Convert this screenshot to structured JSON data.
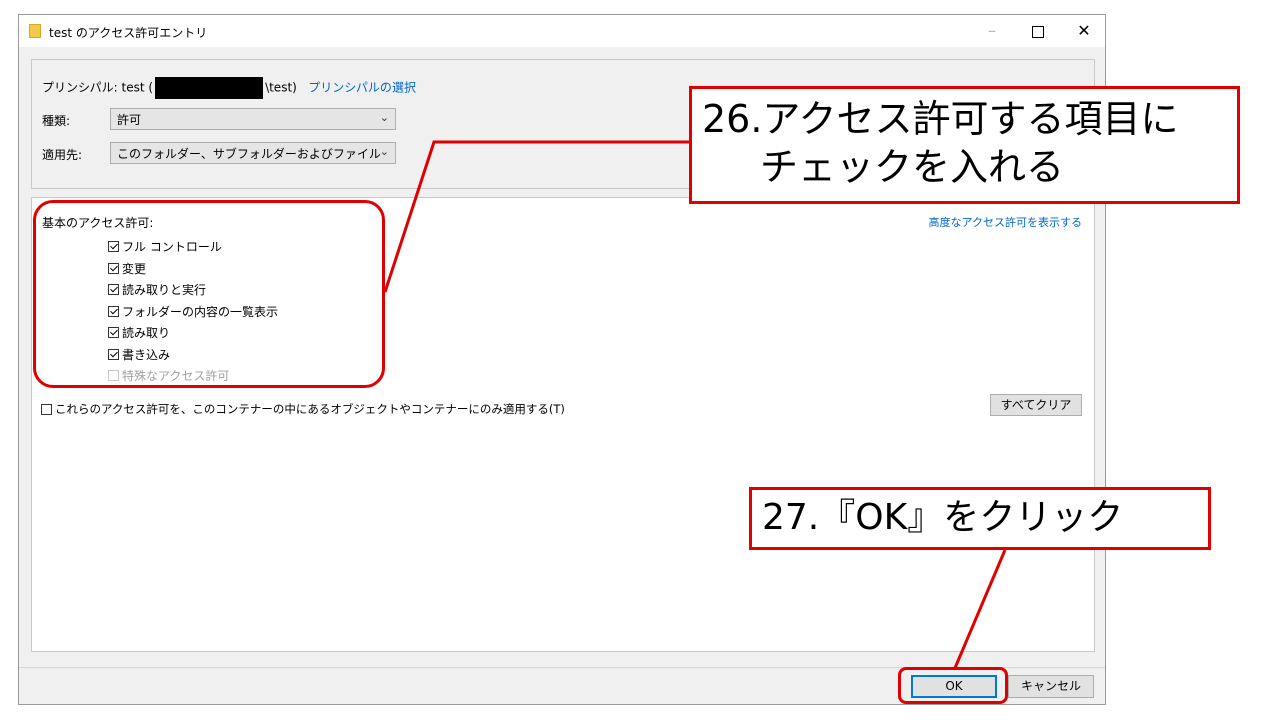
{
  "window": {
    "title": "test のアクセス許可エントリ",
    "controls": {
      "minimize": "–",
      "maximize": "",
      "close": "✕"
    }
  },
  "principal": {
    "label": "プリンシパル:",
    "name_prefix": "test (",
    "name_suffix": "\\test)",
    "select_link": "プリンシパルの選択"
  },
  "type_field": {
    "label": "種類:",
    "value": "許可"
  },
  "applies_field": {
    "label": "適用先:",
    "value": "このフォルダー、サブフォルダーおよびファイル"
  },
  "permissions": {
    "heading": "基本のアクセス許可:",
    "advanced_link": "高度なアクセス許可を表示する",
    "items": [
      {
        "label": "フル コントロール",
        "checked": true,
        "enabled": true
      },
      {
        "label": "変更",
        "checked": true,
        "enabled": true
      },
      {
        "label": "読み取りと実行",
        "checked": true,
        "enabled": true
      },
      {
        "label": "フォルダーの内容の一覧表示",
        "checked": true,
        "enabled": true
      },
      {
        "label": "読み取り",
        "checked": true,
        "enabled": true
      },
      {
        "label": "書き込み",
        "checked": true,
        "enabled": true
      },
      {
        "label": "特殊なアクセス許可",
        "checked": false,
        "enabled": false
      }
    ],
    "apply_only_label": "これらのアクセス許可を、このコンテナーの中にあるオブジェクトやコンテナーにのみ適用する(T)",
    "clear_all_label": "すべてクリア"
  },
  "buttons": {
    "ok": "OK",
    "cancel": "キャンセル"
  },
  "annotations": {
    "step26_line1": "26.アクセス許可する項目に",
    "step26_line2": "チェックを入れる",
    "step27": "27.『OK』をクリック",
    "color": "#e00000"
  }
}
